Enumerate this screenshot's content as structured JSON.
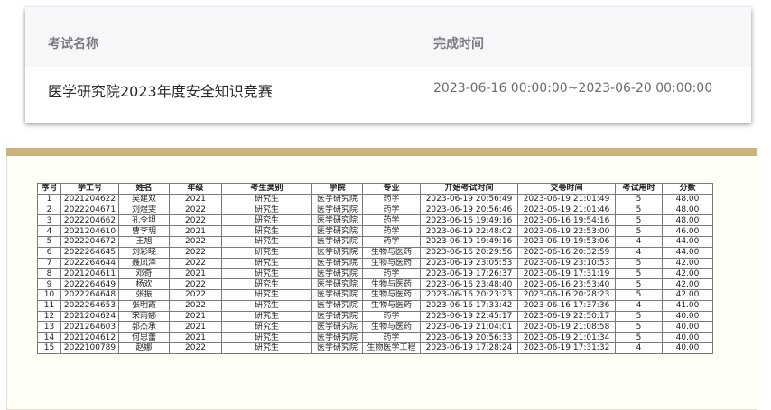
{
  "exam_card": {
    "col_name_label": "考试名称",
    "col_time_label": "完成时间",
    "exam_name": "医学研究院2023年度安全知识竞赛",
    "exam_time": "2023-06-16 00:00:00~2023-06-20 00:00:00"
  },
  "table": {
    "headers": [
      "序号",
      "学工号",
      "姓名",
      "年级",
      "考生类别",
      "学院",
      "专业",
      "开始考试时间",
      "交卷时间",
      "考试用时",
      "分数"
    ],
    "rows": [
      [
        "1",
        "2021204622",
        "吴建双",
        "2021",
        "研究生",
        "医学研究院",
        "药学",
        "2023-06-19 20:56:49",
        "2023-06-19 21:01:49",
        "5",
        "48.00"
      ],
      [
        "2",
        "2022204671",
        "刘煜雯",
        "2022",
        "研究生",
        "医学研究院",
        "药学",
        "2023-06-19 20:56:46",
        "2023-06-19 21:01:46",
        "5",
        "48.00"
      ],
      [
        "3",
        "2022204662",
        "孔令坦",
        "2022",
        "研究生",
        "医学研究院",
        "药学",
        "2023-06-16 19:49:16",
        "2023-06-16 19:54:16",
        "5",
        "48.00"
      ],
      [
        "4",
        "2021204610",
        "曹李玥",
        "2021",
        "研究生",
        "医学研究院",
        "药学",
        "2023-06-19 22:48:02",
        "2023-06-19 22:53:00",
        "5",
        "46.00"
      ],
      [
        "5",
        "2022204672",
        "王旭",
        "2022",
        "研究生",
        "医学研究院",
        "药学",
        "2023-06-19 19:49:16",
        "2023-06-19 19:53:06",
        "4",
        "44.00"
      ],
      [
        "6",
        "2022264645",
        "刘彩晓",
        "2022",
        "研究生",
        "医学研究院",
        "生物与医药",
        "2023-06-16 20:29:56",
        "2023-06-16 20:32:59",
        "4",
        "44.00"
      ],
      [
        "7",
        "2022264644",
        "聂凤泽",
        "2022",
        "研究生",
        "医学研究院",
        "生物与医药",
        "2023-06-19 23:05:53",
        "2023-06-19 23:10:53",
        "5",
        "42.00"
      ],
      [
        "8",
        "2021204611",
        "邓奇",
        "2021",
        "研究生",
        "医学研究院",
        "药学",
        "2023-06-19 17:26:37",
        "2023-06-19 17:31:19",
        "5",
        "42.00"
      ],
      [
        "9",
        "2022264649",
        "杨欢",
        "2022",
        "研究生",
        "医学研究院",
        "生物与医药",
        "2023-06-16 23:48:40",
        "2023-06-16 23:53:40",
        "5",
        "42.00"
      ],
      [
        "10",
        "2022264648",
        "张振",
        "2022",
        "研究生",
        "医学研究院",
        "生物与医药",
        "2023-06-16 20:23:23",
        "2023-06-16 20:28:23",
        "5",
        "42.00"
      ],
      [
        "11",
        "2022264653",
        "张明霞",
        "2022",
        "研究生",
        "医学研究院",
        "生物与医药",
        "2023-06-16 17:33:42",
        "2023-06-16 17:37:36",
        "4",
        "41.00"
      ],
      [
        "12",
        "2021204624",
        "宋雨娜",
        "2021",
        "研究生",
        "医学研究院",
        "药学",
        "2023-06-19 22:45:17",
        "2023-06-19 22:50:17",
        "5",
        "40.00"
      ],
      [
        "13",
        "2021264603",
        "郭杰承",
        "2021",
        "研究生",
        "医学研究院",
        "生物与医药",
        "2023-06-19 21:04:01",
        "2023-06-19 21:08:58",
        "5",
        "40.00"
      ],
      [
        "14",
        "2021204612",
        "何思蕾",
        "2021",
        "研究生",
        "医学研究院",
        "药学",
        "2023-06-19 20:56:33",
        "2023-06-19 21:01:34",
        "5",
        "40.00"
      ],
      [
        "15",
        "2022100789",
        "赵娜",
        "2022",
        "研究生",
        "医学研究院",
        "生物医学工程",
        "2023-06-19 17:28:24",
        "2023-06-19 17:31:32",
        "4",
        "40.00"
      ]
    ]
  },
  "colors": {
    "sheet_top_border": "#cdb27c",
    "header_text": "#7b7b86",
    "card_header_bg": "#f7f7f9"
  }
}
